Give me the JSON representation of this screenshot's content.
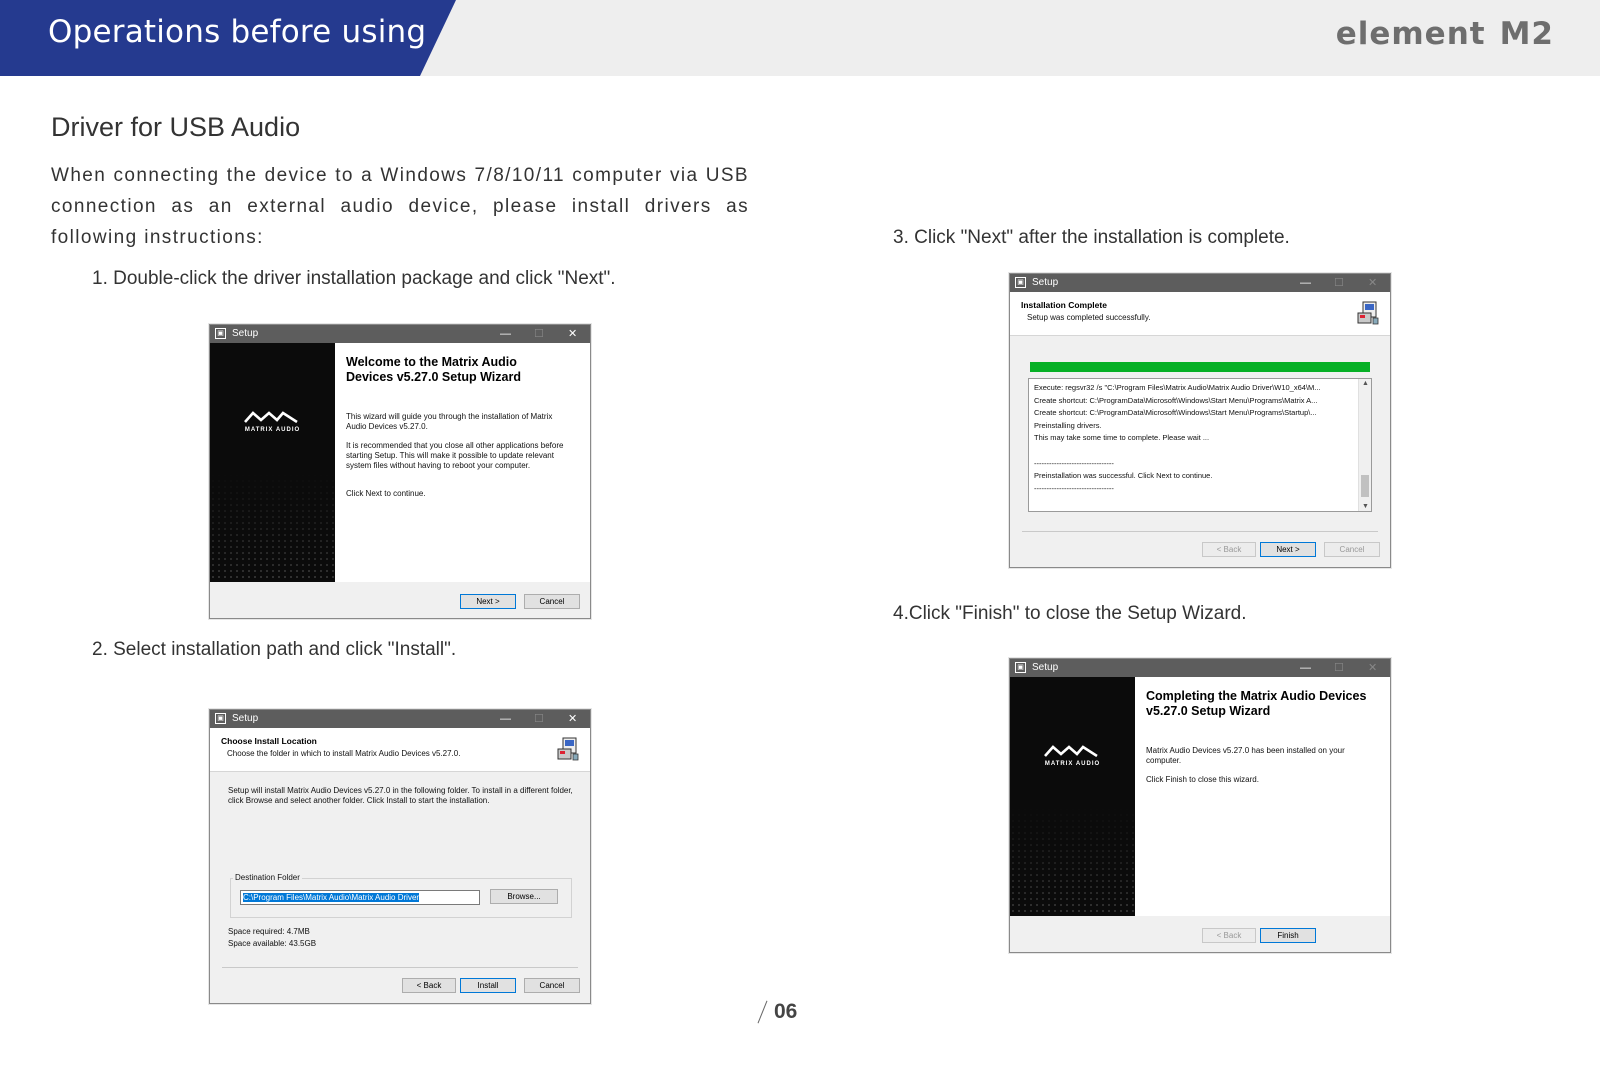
{
  "header": {
    "title": "Operations before using",
    "brand": "element",
    "brand_model": "M2"
  },
  "section": {
    "title": "Driver for USB Audio",
    "intro": "When connecting the device to a Windows 7/8/10/11 computer via USB connection as an external audio device, please install drivers as following instructions:"
  },
  "steps": [
    "1. Double-click the driver installation package and click \"Next\".",
    "2. Select installation path and click \"Install\".",
    "3. Click \"Next\" after the installation is complete.",
    "4.Click \"Finish\" to close the Setup Wizard."
  ],
  "dialog_common": {
    "title": "Setup",
    "minimize": "—",
    "maximize": "☐",
    "close": "✕",
    "logo_text": "MATRIX AUDIO"
  },
  "dialog1": {
    "heading": "Welcome to the Matrix Audio Devices v5.27.0 Setup Wizard",
    "p1": "This wizard will guide you through the installation of Matrix Audio Devices v5.27.0.",
    "p2": "It is recommended that you close all other applications before starting Setup. This will make it possible to update relevant system files without having to reboot your computer.",
    "p3": "Click Next to continue.",
    "next": "Next >",
    "cancel": "Cancel"
  },
  "dialog2": {
    "header_title": "Choose Install Location",
    "header_sub": "Choose the folder in which to install Matrix Audio Devices v5.27.0.",
    "body": "Setup will install Matrix Audio Devices v5.27.0 in the following folder. To install in a different folder, click Browse and select another folder. Click Install to start the installation.",
    "group_label": "Destination Folder",
    "path": "C:\\Program Files\\Matrix Audio\\Matrix Audio Driver",
    "browse": "Browse...",
    "space_required": "Space required: 4.7MB",
    "space_available": "Space available: 43.5GB",
    "back": "< Back",
    "install": "Install",
    "cancel": "Cancel"
  },
  "dialog3": {
    "header_title": "Installation Complete",
    "header_sub": "Setup was completed successfully.",
    "progress": 1.0,
    "log": [
      "Execute: regsvr32 /s \"C:\\Program Files\\Matrix Audio\\Matrix Audio Driver\\W10_x64\\M...",
      "Create shortcut: C:\\ProgramData\\Microsoft\\Windows\\Start Menu\\Programs\\Matrix A...",
      "Create shortcut: C:\\ProgramData\\Microsoft\\Windows\\Start Menu\\Programs\\Startup\\...",
      "Preinstalling drivers.",
      "This may take some time to complete. Please wait ...",
      "",
      "--------------------------------",
      "Preinstallation was successful. Click Next to continue.",
      "--------------------------------"
    ],
    "back": "< Back",
    "next": "Next >",
    "cancel": "Cancel"
  },
  "dialog4": {
    "heading": "Completing the Matrix Audio Devices v5.27.0 Setup Wizard",
    "p1": "Matrix Audio Devices v5.27.0 has been installed on your computer.",
    "p2": "Click Finish to close this wizard.",
    "back": "< Back",
    "finish": "Finish"
  },
  "footer": {
    "page": "06"
  },
  "colors": {
    "header_blue": "#253a8f",
    "header_gray": "#eeeeee",
    "progress_green": "#06b025",
    "focus_blue": "#0078d7"
  }
}
